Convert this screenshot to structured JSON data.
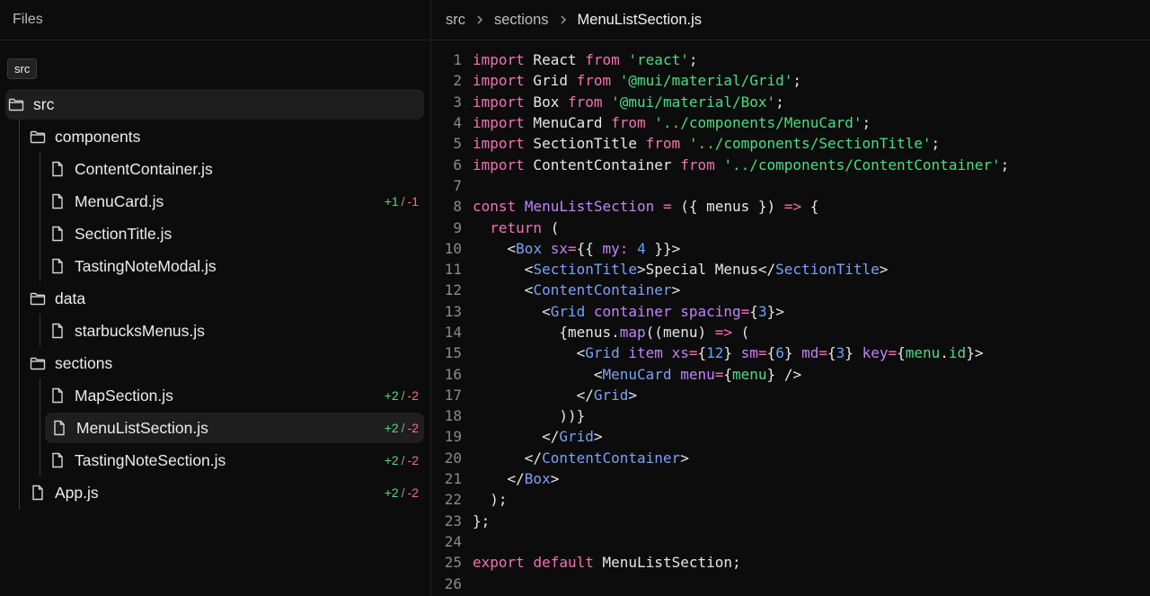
{
  "sidebar": {
    "title": "Files",
    "tooltip": "src",
    "tree": [
      {
        "label": "src",
        "type": "folder",
        "depth": 0,
        "selected_parent": true
      },
      {
        "label": "components",
        "type": "folder",
        "depth": 1
      },
      {
        "label": "ContentContainer.js",
        "type": "file",
        "depth": 2
      },
      {
        "label": "MenuCard.js",
        "type": "file",
        "depth": 2,
        "added": "+1",
        "removed": "-1"
      },
      {
        "label": "SectionTitle.js",
        "type": "file",
        "depth": 2
      },
      {
        "label": "TastingNoteModal.js",
        "type": "file",
        "depth": 2
      },
      {
        "label": "data",
        "type": "folder",
        "depth": 1
      },
      {
        "label": "starbucksMenus.js",
        "type": "file",
        "depth": 2
      },
      {
        "label": "sections",
        "type": "folder",
        "depth": 1
      },
      {
        "label": "MapSection.js",
        "type": "file",
        "depth": 2,
        "added": "+2",
        "removed": "-2"
      },
      {
        "label": "MenuListSection.js",
        "type": "file",
        "depth": 2,
        "added": "+2",
        "removed": "-2",
        "selected": true
      },
      {
        "label": "TastingNoteSection.js",
        "type": "file",
        "depth": 2,
        "added": "+2",
        "removed": "-2"
      },
      {
        "label": "App.js",
        "type": "file",
        "depth": 1,
        "added": "+2",
        "removed": "-2"
      }
    ],
    "diff_separator": "/"
  },
  "editor": {
    "breadcrumb": [
      "src",
      "sections",
      "MenuListSection.js"
    ],
    "lines": [
      [
        [
          "kw",
          "import"
        ],
        [
          "t",
          " React "
        ],
        [
          "kw",
          "from"
        ],
        [
          "t",
          " "
        ],
        [
          "str",
          "'react'"
        ],
        [
          "t",
          ";"
        ]
      ],
      [
        [
          "kw",
          "import"
        ],
        [
          "t",
          " Grid "
        ],
        [
          "kw",
          "from"
        ],
        [
          "t",
          " "
        ],
        [
          "str",
          "'@mui/material/Grid'"
        ],
        [
          "t",
          ";"
        ]
      ],
      [
        [
          "kw",
          "import"
        ],
        [
          "t",
          " Box "
        ],
        [
          "kw",
          "from"
        ],
        [
          "t",
          " "
        ],
        [
          "str",
          "'@mui/material/Box'"
        ],
        [
          "t",
          ";"
        ]
      ],
      [
        [
          "kw",
          "import"
        ],
        [
          "t",
          " MenuCard "
        ],
        [
          "kw",
          "from"
        ],
        [
          "t",
          " "
        ],
        [
          "str",
          "'../components/MenuCard'"
        ],
        [
          "t",
          ";"
        ]
      ],
      [
        [
          "kw",
          "import"
        ],
        [
          "t",
          " SectionTitle "
        ],
        [
          "kw",
          "from"
        ],
        [
          "t",
          " "
        ],
        [
          "str",
          "'../components/SectionTitle'"
        ],
        [
          "t",
          ";"
        ]
      ],
      [
        [
          "kw",
          "import"
        ],
        [
          "t",
          " ContentContainer "
        ],
        [
          "kw",
          "from"
        ],
        [
          "t",
          " "
        ],
        [
          "str",
          "'../components/ContentContainer'"
        ],
        [
          "t",
          ";"
        ]
      ],
      [],
      [
        [
          "kw",
          "const"
        ],
        [
          "t",
          " "
        ],
        [
          "fn",
          "MenuListSection"
        ],
        [
          "t",
          " "
        ],
        [
          "op",
          "="
        ],
        [
          "t",
          " ({ menus }) "
        ],
        [
          "op",
          "=>"
        ],
        [
          "t",
          " {"
        ]
      ],
      [
        [
          "t",
          "  "
        ],
        [
          "kw",
          "return"
        ],
        [
          "t",
          " ("
        ]
      ],
      [
        [
          "t",
          "    <"
        ],
        [
          "tag",
          "Box"
        ],
        [
          "t",
          " "
        ],
        [
          "attr",
          "sx"
        ],
        [
          "op",
          "="
        ],
        [
          "t",
          "{{ "
        ],
        [
          "attr",
          "my"
        ],
        [
          "op",
          ":"
        ],
        [
          "t",
          " "
        ],
        [
          "num",
          "4"
        ],
        [
          "t",
          " }}>"
        ]
      ],
      [
        [
          "t",
          "      <"
        ],
        [
          "tag",
          "SectionTitle"
        ],
        [
          "t",
          ">Special Menus</"
        ],
        [
          "tag",
          "SectionTitle"
        ],
        [
          "t",
          ">"
        ]
      ],
      [
        [
          "t",
          "      <"
        ],
        [
          "tag",
          "ContentContainer"
        ],
        [
          "t",
          ">"
        ]
      ],
      [
        [
          "t",
          "        <"
        ],
        [
          "tag",
          "Grid"
        ],
        [
          "t",
          " "
        ],
        [
          "attr",
          "container"
        ],
        [
          "t",
          " "
        ],
        [
          "attr",
          "spacing"
        ],
        [
          "op",
          "="
        ],
        [
          "t",
          "{"
        ],
        [
          "num",
          "3"
        ],
        [
          "t",
          "}>"
        ]
      ],
      [
        [
          "t",
          "          {menus."
        ],
        [
          "fn",
          "map"
        ],
        [
          "t",
          "((menu) "
        ],
        [
          "op",
          "=>"
        ],
        [
          "t",
          " ("
        ]
      ],
      [
        [
          "t",
          "            <"
        ],
        [
          "tag",
          "Grid"
        ],
        [
          "t",
          " "
        ],
        [
          "attr",
          "item"
        ],
        [
          "t",
          " "
        ],
        [
          "attr",
          "xs"
        ],
        [
          "op",
          "="
        ],
        [
          "t",
          "{"
        ],
        [
          "num",
          "12"
        ],
        [
          "t",
          "} "
        ],
        [
          "attr",
          "sm"
        ],
        [
          "op",
          "="
        ],
        [
          "t",
          "{"
        ],
        [
          "num",
          "6"
        ],
        [
          "t",
          "} "
        ],
        [
          "attr",
          "md"
        ],
        [
          "op",
          "="
        ],
        [
          "t",
          "{"
        ],
        [
          "num",
          "3"
        ],
        [
          "t",
          "} "
        ],
        [
          "attr",
          "key"
        ],
        [
          "op",
          "="
        ],
        [
          "t",
          "{"
        ],
        [
          "str",
          "menu"
        ],
        [
          "t",
          "."
        ],
        [
          "str",
          "id"
        ],
        [
          "t",
          "}>"
        ]
      ],
      [
        [
          "t",
          "              <"
        ],
        [
          "tag",
          "MenuCard"
        ],
        [
          "t",
          " "
        ],
        [
          "attr",
          "menu"
        ],
        [
          "op",
          "="
        ],
        [
          "t",
          "{"
        ],
        [
          "str",
          "menu"
        ],
        [
          "t",
          "} />"
        ]
      ],
      [
        [
          "t",
          "            </"
        ],
        [
          "tag",
          "Grid"
        ],
        [
          "t",
          ">"
        ]
      ],
      [
        [
          "t",
          "          ))}"
        ]
      ],
      [
        [
          "t",
          "        </"
        ],
        [
          "tag",
          "Grid"
        ],
        [
          "t",
          ">"
        ]
      ],
      [
        [
          "t",
          "      </"
        ],
        [
          "tag",
          "ContentContainer"
        ],
        [
          "t",
          ">"
        ]
      ],
      [
        [
          "t",
          "    </"
        ],
        [
          "tag",
          "Box"
        ],
        [
          "t",
          ">"
        ]
      ],
      [
        [
          "t",
          "  );"
        ]
      ],
      [
        [
          "t",
          "};"
        ]
      ],
      [],
      [
        [
          "kw",
          "export"
        ],
        [
          "t",
          " "
        ],
        [
          "kw",
          "default"
        ],
        [
          "t",
          " MenuListSection;"
        ]
      ],
      []
    ]
  }
}
